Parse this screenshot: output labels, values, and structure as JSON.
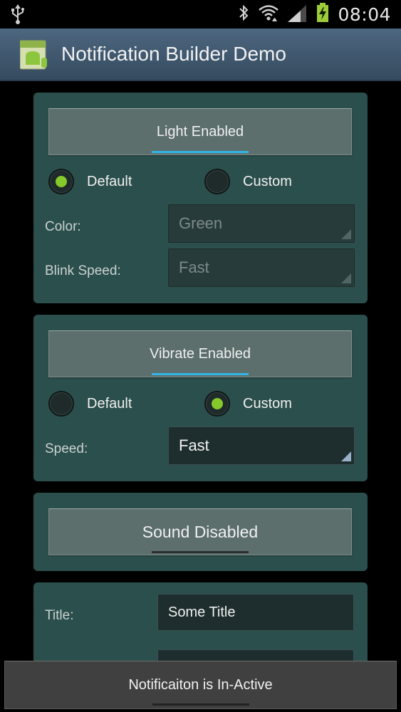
{
  "status_bar": {
    "time": "08:04",
    "icons": [
      "usb-icon",
      "bluetooth-icon",
      "wifi-icon",
      "signal-icon",
      "battery-charging-icon"
    ]
  },
  "action_bar": {
    "title": "Notification Builder Demo",
    "icon": "android-app-icon"
  },
  "light": {
    "toggle_label": "Light Enabled",
    "toggle_on": true,
    "radio_default": "Default",
    "radio_custom": "Custom",
    "selected": "Default",
    "color_label": "Color:",
    "color_value": "Green",
    "blink_label": "Blink Speed:",
    "blink_value": "Fast"
  },
  "vibrate": {
    "toggle_label": "Vibrate Enabled",
    "toggle_on": true,
    "radio_default": "Default",
    "radio_custom": "Custom",
    "selected": "Custom",
    "speed_label": "Speed:",
    "speed_value": "Fast"
  },
  "sound": {
    "toggle_label": "Sound Disabled",
    "toggle_on": false
  },
  "text": {
    "title_label": "Title:",
    "title_value": "Some Title"
  },
  "bottom_button": {
    "label": "Notificaiton is In-Active"
  },
  "colors": {
    "accent": "#33b5e5",
    "radio_selected": "#86c92a",
    "card": "#2b4f4c",
    "action_bar": "#4d6780"
  }
}
